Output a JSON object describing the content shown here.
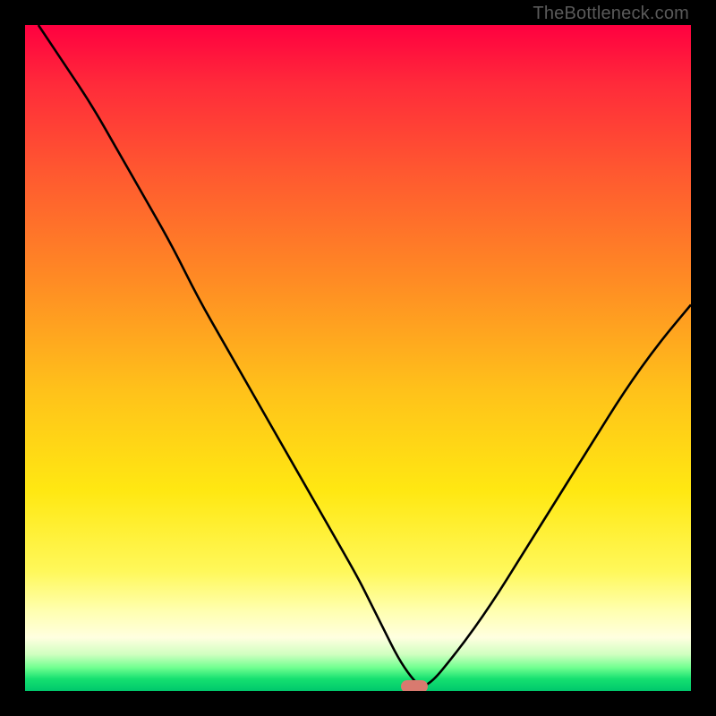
{
  "watermark": "TheBottleneck.com",
  "chart_data": {
    "type": "line",
    "title": "",
    "xlabel": "",
    "ylabel": "",
    "xlim": [
      0,
      100
    ],
    "ylim": [
      0,
      100
    ],
    "x": [
      2,
      6,
      10,
      14,
      18,
      22,
      26,
      30,
      34,
      38,
      42,
      46,
      50,
      52,
      54,
      56,
      58,
      60,
      65,
      70,
      75,
      80,
      85,
      90,
      95,
      100
    ],
    "values": [
      100,
      94,
      88,
      81,
      74,
      67,
      59,
      52,
      45,
      38,
      31,
      24,
      17,
      13,
      9,
      5,
      2,
      0,
      6,
      13,
      21,
      29,
      37,
      45,
      52,
      58
    ],
    "minimum_x": 60,
    "minimum_y": 0,
    "marker": {
      "x": 58.5,
      "width_pct": 4.0
    },
    "colors": {
      "curve": "#000000",
      "marker": "#d97a6f",
      "gradient_top": "#ff0040",
      "gradient_bottom": "#00c86c"
    }
  }
}
